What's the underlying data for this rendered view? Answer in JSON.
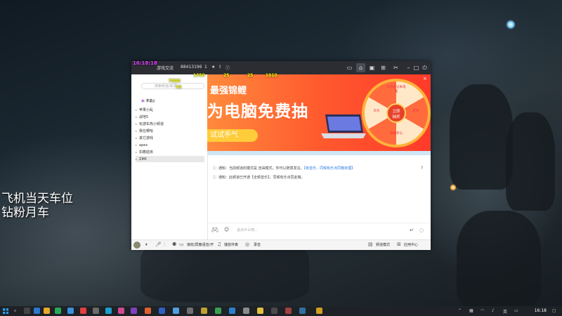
{
  "overlay": {
    "time": "16:18:18",
    "line1": "飞机当天车位",
    "line2": "钻粉月车",
    "stats": [
      "1350",
      "25",
      "25",
      "1010",
      "7000",
      "70"
    ]
  },
  "window": {
    "room_name": "游戏交流",
    "room_id": "88413196",
    "online_count": "1",
    "search_placeholder": "搜索频道/成员",
    "me_label": "准备jj"
  },
  "channels": [
    {
      "label": "苹果小乱"
    },
    {
      "label": "战地5"
    },
    {
      "label": "玩游车热小频道"
    },
    {
      "label": "我在哪哈"
    },
    {
      "label": "其它游戏"
    },
    {
      "label": "apex"
    },
    {
      "label": "扣着莊房"
    },
    {
      "label": "ZIMI"
    }
  ],
  "banner": {
    "title": "最强锦鲤",
    "big": "为电脑免费抽",
    "button": "试试手气",
    "wheel_center": [
      "立即",
      "抽奖"
    ],
    "wheel_labels": [
      "华为笔记本电脑",
      "华为",
      "谢谢参与",
      "华为"
    ]
  },
  "notices": [
    {
      "icon": "通知",
      "text": "当前频道的模式是 自由模式，你可以随意发言。",
      "link": "【有音乐、同候有乐点同格有理】"
    },
    {
      "icon": "通知",
      "text": "此频道已开通【全频音乐】，同候有乐点同此格。",
      "link": ""
    }
  ],
  "input": {
    "placeholder": "说点什么吧..."
  },
  "bottombar": {
    "item1": "接收/屏蔽语音/开",
    "item2": "播放伴奏",
    "item3": "录音",
    "item4": "频道模式",
    "item5": "应用中心"
  },
  "taskbar": {
    "time": "16:18"
  }
}
